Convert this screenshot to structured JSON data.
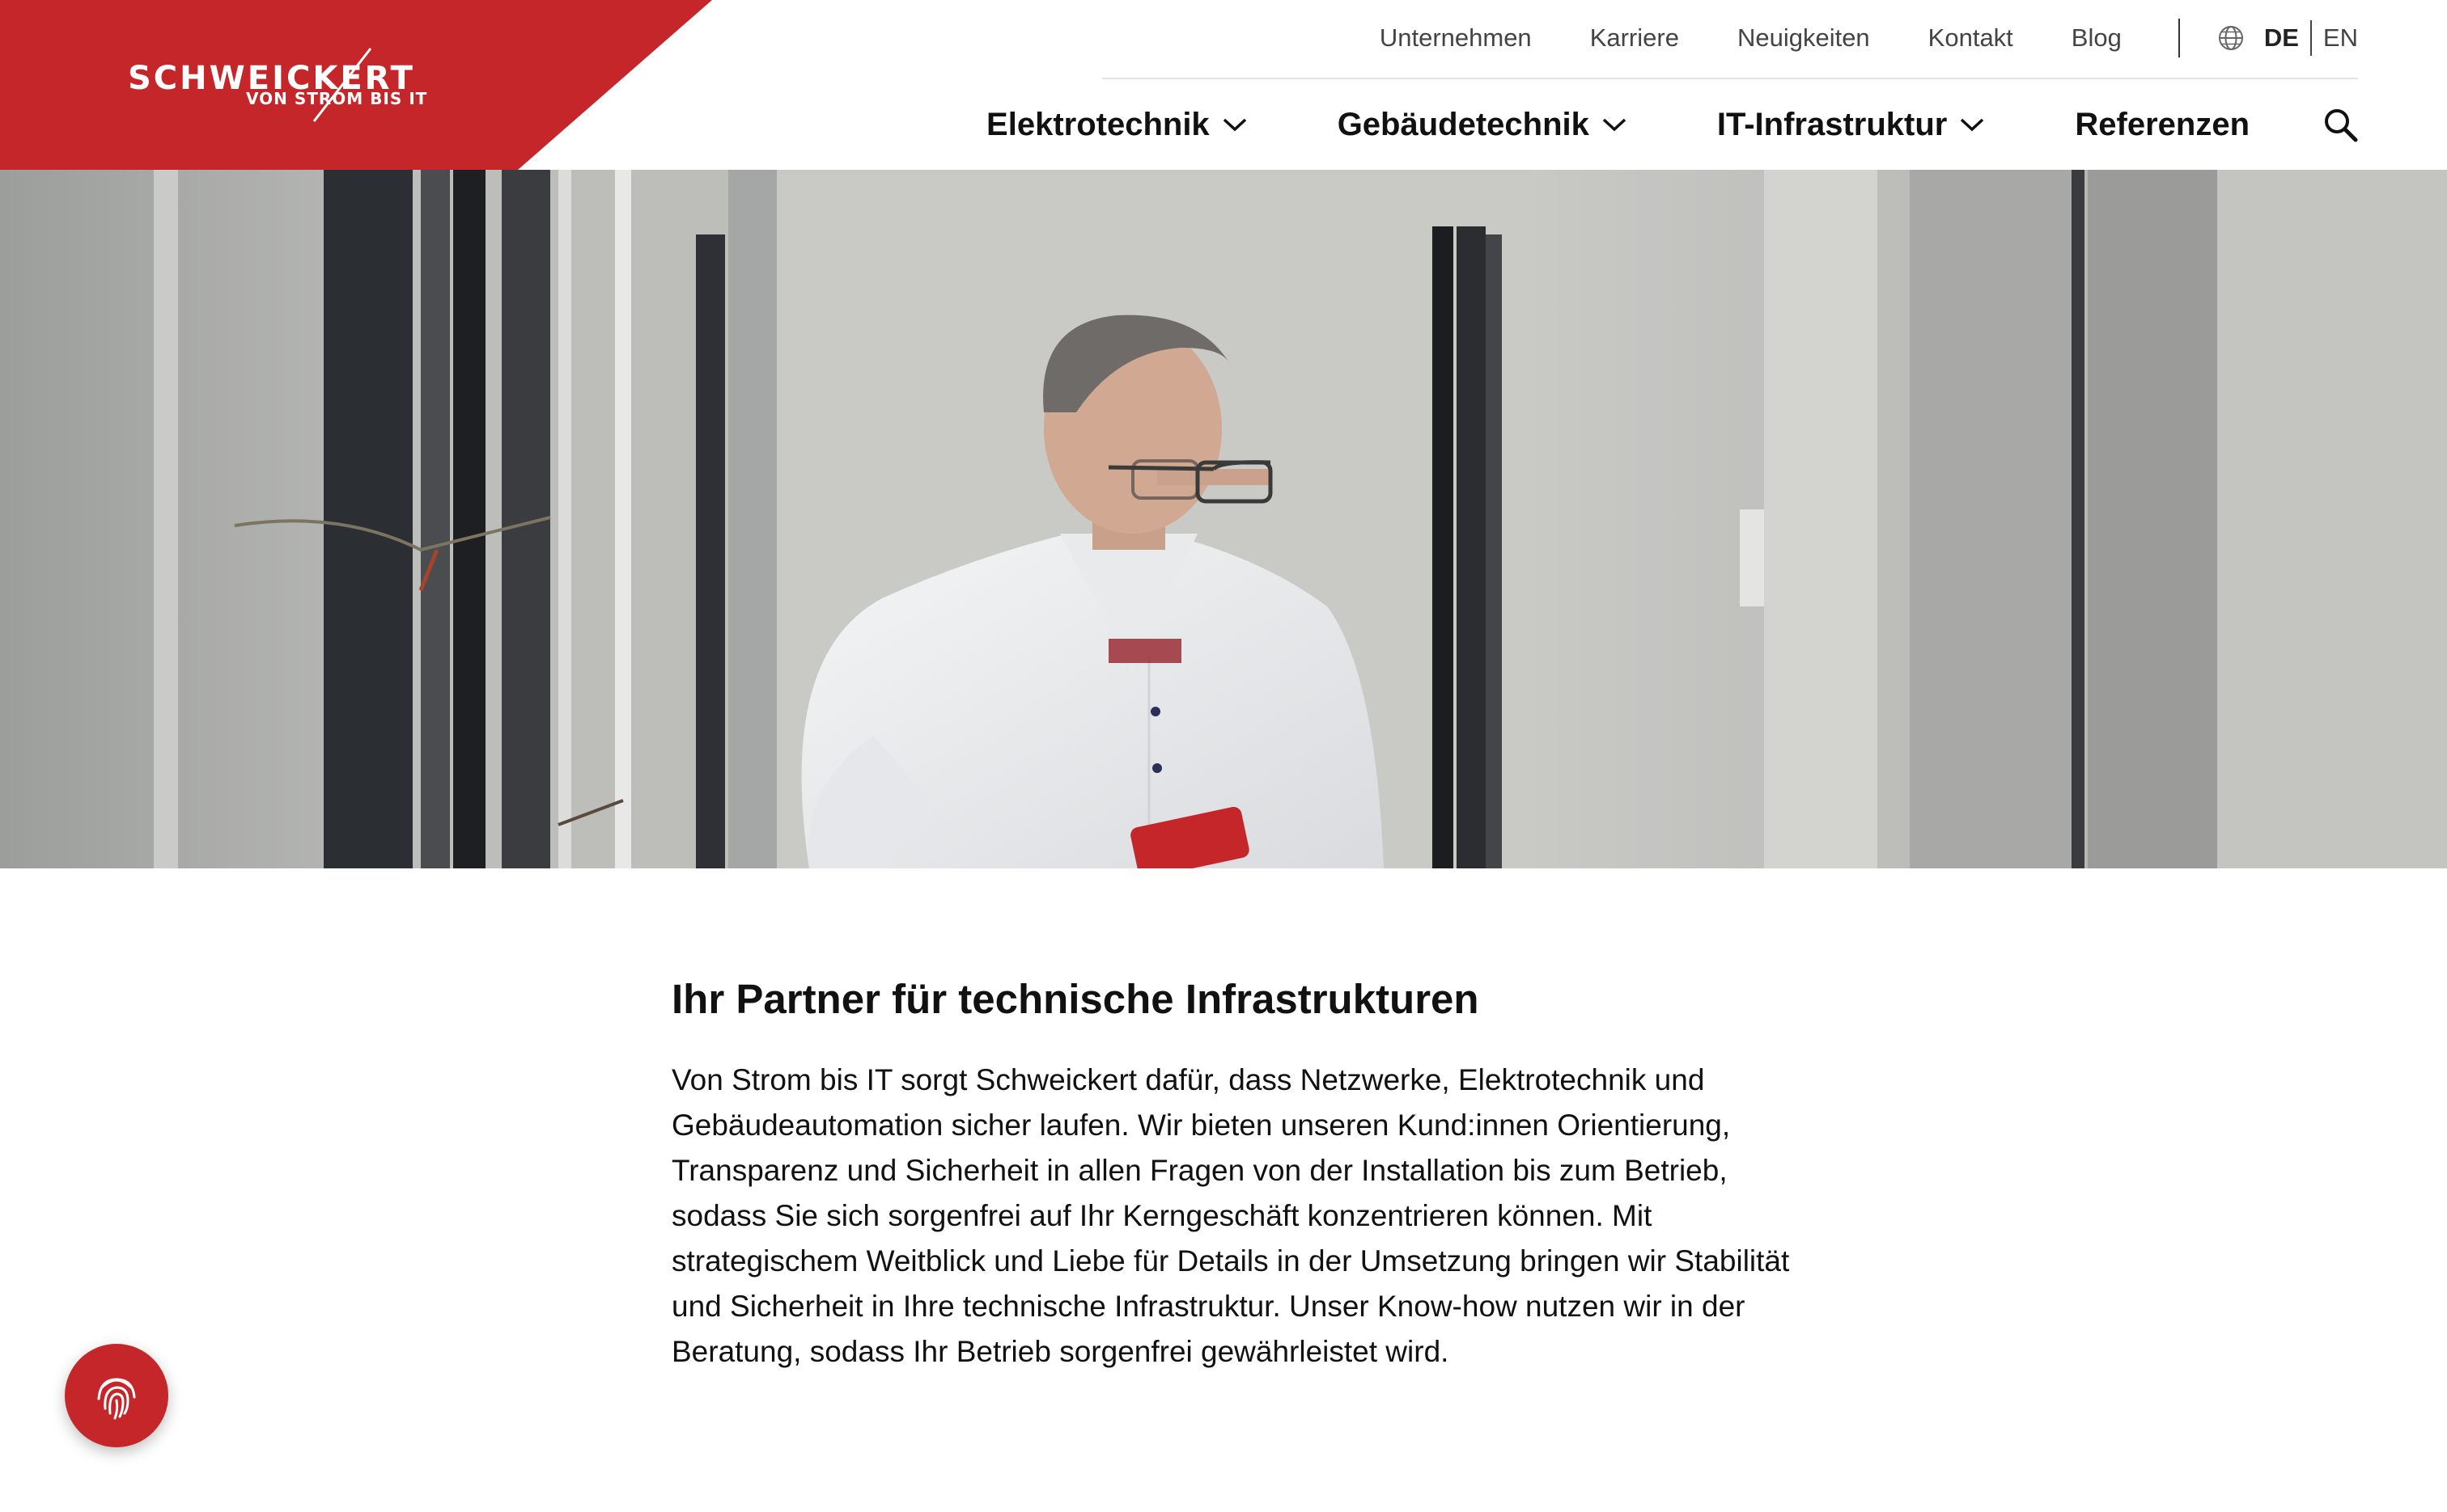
{
  "brand": {
    "name": "SCHWEICKERT",
    "tagline": "VON STROM BIS IT",
    "color": "#c4262a"
  },
  "topnav": {
    "items": [
      "Unternehmen",
      "Karriere",
      "Neuigkeiten",
      "Kontakt",
      "Blog"
    ],
    "languages": [
      "DE",
      "EN"
    ],
    "active_language": "DE"
  },
  "mainnav": {
    "items": [
      {
        "label": "Elektrotechnik",
        "has_dropdown": true
      },
      {
        "label": "Gebäudetechnik",
        "has_dropdown": true
      },
      {
        "label": "IT-Infrastruktur",
        "has_dropdown": true
      },
      {
        "label": "Referenzen",
        "has_dropdown": false
      }
    ],
    "search_icon": "search-icon"
  },
  "hero": {
    "icon": "hero-photo"
  },
  "intro": {
    "heading": "Ihr Partner für technische Infrastrukturen",
    "body": "Von Strom bis IT sorgt Schweickert dafür, dass Netzwerke, Elektrotechnik und Gebäudeautomation sicher laufen. Wir bieten unseren Kund:innen Orientierung, Transparenz und Sicherheit in allen Fragen von der Installation bis zum Betrieb, sodass Sie sich sorgenfrei auf Ihr Kerngeschäft konzentrieren können. Mit strategischem Weitblick und Liebe für Details in der Umsetzung bringen wir Stabilität und Sicherheit in Ihre technische Infrastruktur. Unser Know-how nutzen wir in der Beratung, sodass Ihr Betrieb sorgenfrei gewährleistet wird."
  },
  "cookie_button": {
    "icon": "fingerprint-icon"
  }
}
